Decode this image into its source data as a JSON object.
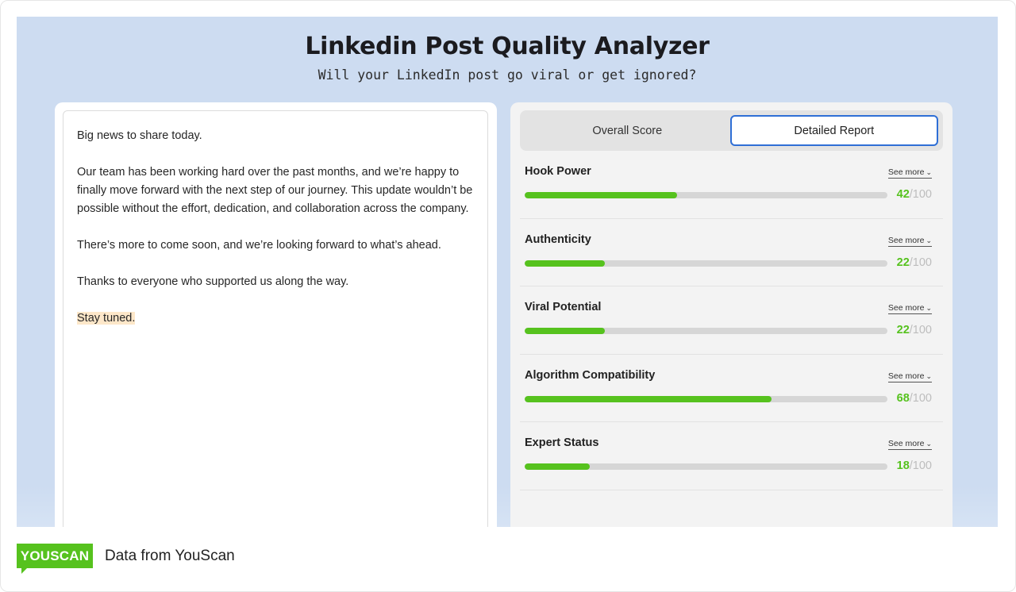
{
  "header": {
    "title": "Linkedin Post Quality Analyzer",
    "subtitle": "Will your LinkedIn post go viral or get ignored?"
  },
  "post": {
    "paragraphs": [
      "Big news to share today.",
      "Our team has been working hard over the past months, and we’re happy to finally move forward with the next step of our journey. This update wouldn’t be possible without the effort, dedication, and collaboration across the company.",
      "There’s more to come soon, and we’re looking forward to what’s ahead.",
      "Thanks to everyone who supported us along the way."
    ],
    "highlighted": "Stay tuned."
  },
  "tabs": [
    {
      "label": "Overall Score",
      "active": false
    },
    {
      "label": "Detailed Report",
      "active": true
    }
  ],
  "see_more_label": "See more",
  "metrics": [
    {
      "name": "Hook Power",
      "score": 42,
      "max": "/100"
    },
    {
      "name": "Authenticity",
      "score": 22,
      "max": "/100"
    },
    {
      "name": "Viral Potential",
      "score": 22,
      "max": "/100"
    },
    {
      "name": "Algorithm Compatibility",
      "score": 68,
      "max": "/100"
    },
    {
      "name": "Expert Status",
      "score": 18,
      "max": "/100"
    }
  ],
  "colors": {
    "background": "#cddcf1",
    "accent_green": "#56c21e",
    "active_tab_border": "#2f6fd6",
    "highlight": "#fde7c9"
  },
  "footer": {
    "logo_text": "YOUSCAN",
    "source": "Data from YouScan"
  }
}
